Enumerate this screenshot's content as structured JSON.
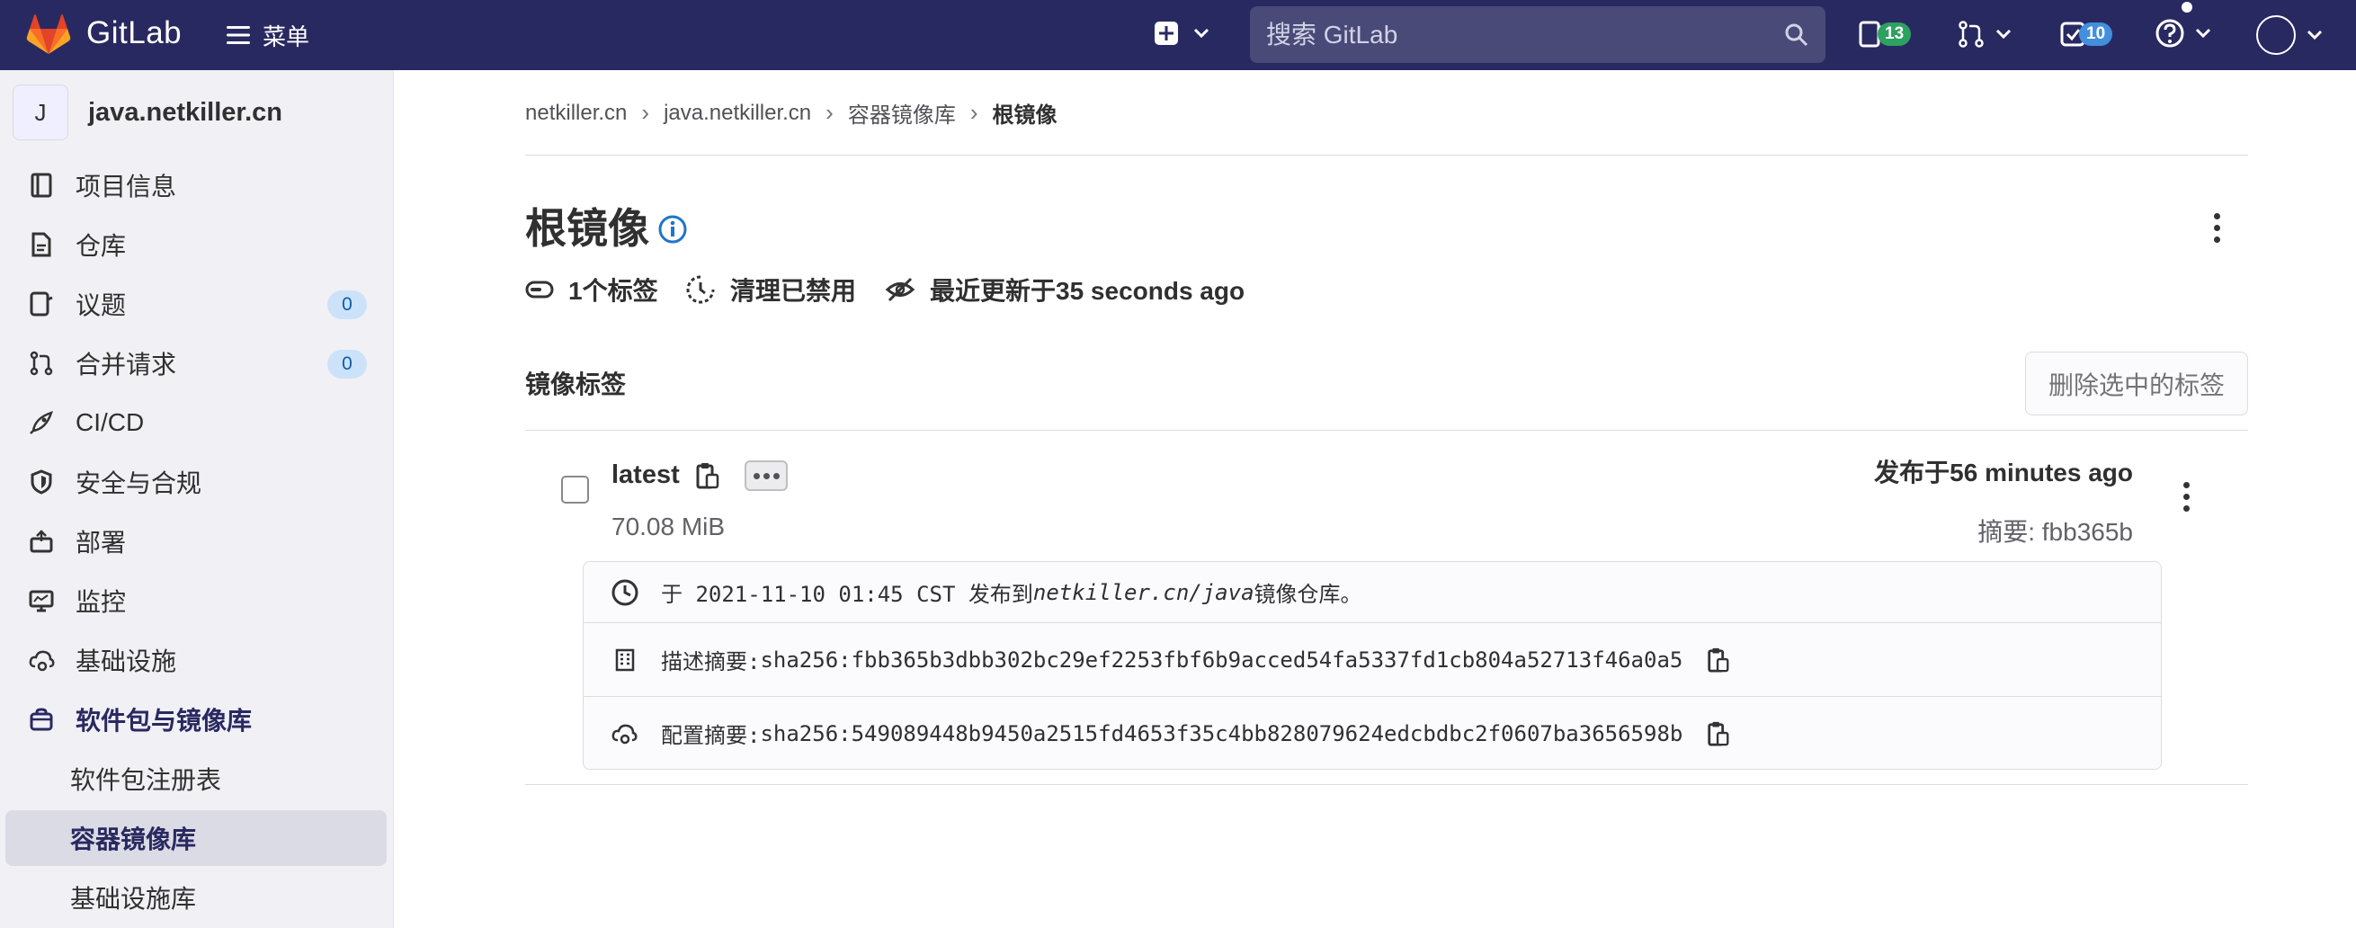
{
  "navbar": {
    "brand": "GitLab",
    "menu_label": "菜单",
    "search_placeholder": "搜索 GitLab",
    "issues_count": "13",
    "todos_count": "10"
  },
  "sidebar": {
    "project_initial": "J",
    "project_name": "java.netkiller.cn",
    "items": [
      {
        "label": "项目信息"
      },
      {
        "label": "仓库"
      },
      {
        "label": "议题",
        "count": "0"
      },
      {
        "label": "合并请求",
        "count": "0"
      },
      {
        "label": "CI/CD"
      },
      {
        "label": "安全与合规"
      },
      {
        "label": "部署"
      },
      {
        "label": "监控"
      },
      {
        "label": "基础设施"
      },
      {
        "label": "软件包与镜像库"
      }
    ],
    "subitems": [
      {
        "label": "软件包注册表"
      },
      {
        "label": "容器镜像库"
      },
      {
        "label": "基础设施库"
      }
    ]
  },
  "breadcrumb": [
    "netkiller.cn",
    "java.netkiller.cn",
    "容器镜像库",
    "根镜像"
  ],
  "page": {
    "title": "根镜像",
    "tag_count": "1个标签",
    "cleanup": "清理已禁用",
    "updated": "最近更新于35 seconds ago"
  },
  "tags_section": {
    "title": "镜像标签",
    "delete_button": "删除选中的标签"
  },
  "tag": {
    "name": "latest",
    "size": "70.08 MiB",
    "published": "发布于56 minutes ago",
    "digest_short": "摘要: fbb365b",
    "published_line_prefix": "于 2021-11-10 01:45 CST 发布到",
    "published_line_path": "netkiller.cn/java",
    "published_line_suffix": "镜像仓库。",
    "manifest_label": "描述摘要: ",
    "manifest_digest": "sha256:fbb365b3dbb302bc29ef2253fbf6b9acced54fa5337fd1cb804a52713f46a0a5",
    "config_label": "配置摘要: ",
    "config_digest": "sha256:549089448b9450a2515fd4653f35c4bb828079624edcbdbc2f0607ba3656598b"
  },
  "colors": {
    "navbar": "#292961",
    "sidebar": "#f0f0f5",
    "active_text": "#292961",
    "badge_green": "#2da160",
    "badge_blue": "#428fdc"
  }
}
